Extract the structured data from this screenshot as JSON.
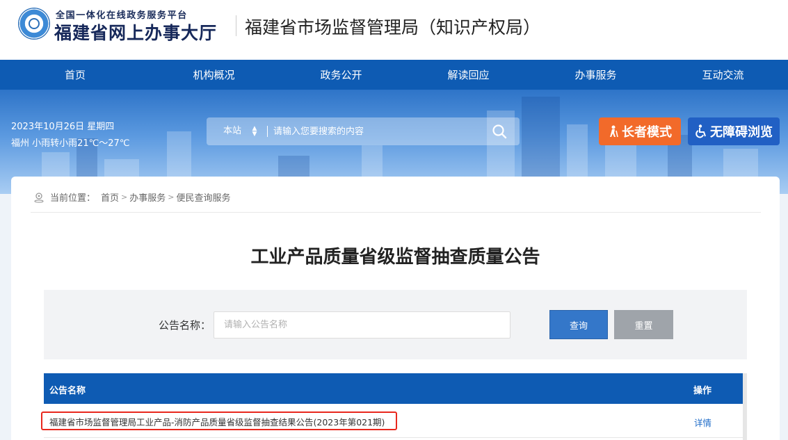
{
  "header": {
    "platform_top": "全国一体化在线政务服务平台",
    "platform_main": "福建省网上办事大厅",
    "department": "福建省市场监督管理局（知识产权局）"
  },
  "nav": {
    "items": [
      {
        "label": "首页"
      },
      {
        "label": "机构概况"
      },
      {
        "label": "政务公开"
      },
      {
        "label": "解读回应"
      },
      {
        "label": "办事服务"
      },
      {
        "label": "互动交流"
      }
    ]
  },
  "banner": {
    "date": "2023年10月26日 星期四",
    "weather": "福州 小雨转小雨21℃～27℃",
    "search": {
      "scope": "本站",
      "placeholder": "请输入您要搜索的内容"
    },
    "elder_mode": "长者模式",
    "accessible": "无障碍浏览"
  },
  "breadcrumb": {
    "prefix": "当前位置：",
    "items": [
      "首页",
      "办事服务",
      "便民查询服务"
    ]
  },
  "page": {
    "title": "工业产品质量省级监督抽查质量公告"
  },
  "filter": {
    "label": "公告名称：",
    "placeholder": "请输入公告名称",
    "query_label": "查询",
    "reset_label": "重置"
  },
  "table": {
    "headers": {
      "name": "公告名称",
      "action": "操作"
    },
    "rows": [
      {
        "name": "福建省市场监督管理局工业产品-消防产品质量省级监督抽查结果公告(2023年第021期)",
        "action": "详情"
      }
    ]
  },
  "colors": {
    "nav_bg": "#0e5bb3",
    "elder_btn": "#f26a2a",
    "accessible_btn": "#2160c4",
    "query_btn": "#3477c9",
    "reset_btn": "#9fa4aa",
    "highlight": "#e8271d"
  }
}
